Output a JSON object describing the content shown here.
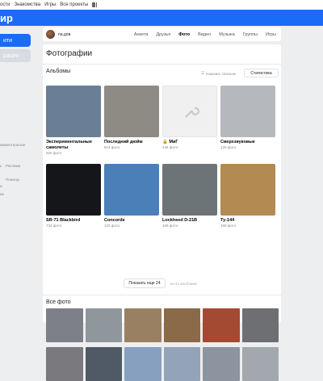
{
  "topnav": {
    "items": [
      "ости",
      "Знакомства",
      "Игры",
      "Все проекты"
    ]
  },
  "header": {
    "title": "ир"
  },
  "sidebar": {
    "active_label": "ити",
    "second_label": "рация",
    "texts": [
      "имментальные",
      "ь",
      "Реклама",
      "Помощь",
      "ы",
      "ие"
    ]
  },
  "profile": {
    "name": "па.дов",
    "tabs": [
      "Анкета",
      "Друзья",
      "Фото",
      "Видео",
      "Музыка",
      "Группы",
      "Игры"
    ],
    "active_tab": "Фото"
  },
  "page": {
    "title": "Фотографии",
    "albums_heading": "Альбомы",
    "show_list": "показать списком",
    "stats_button": "Статистика",
    "more_button": "Показать еще 24",
    "more_sub": "из 44 альбомов",
    "all_photos_heading": "Все фото"
  },
  "albums": [
    {
      "name": "Экспериментальные самолеты",
      "count": "920 фото",
      "color": "#6a7e96"
    },
    {
      "name": "Последний дюйм",
      "count": "814 фото",
      "color": "#8e8a84"
    },
    {
      "name": "🔒 МиГ",
      "count": "446 фото",
      "color": "#f0f0f0"
    },
    {
      "name": "Сверхзвуковые",
      "count": "129 фото",
      "color": "#b5b8bd"
    },
    {
      "name": "SR-71 Blackbird",
      "count": "734 фото",
      "color": "#15161a"
    },
    {
      "name": "Concorde",
      "count": "120 фото",
      "color": "#4a7fb8"
    },
    {
      "name": "Lockheed D-21B",
      "count": "108 фото",
      "color": "#6d7478"
    },
    {
      "name": "Ту-144",
      "count": "169 фото",
      "color": "#b38a52"
    }
  ],
  "all_photos": [
    {
      "color": "#7d8088"
    },
    {
      "color": "#8f969c"
    },
    {
      "color": "#9a8062"
    },
    {
      "color": "#8b6a48"
    },
    {
      "color": "#a54a32"
    },
    {
      "color": "#6e6f72"
    },
    {
      "color": "#7a7a7e"
    },
    {
      "color": "#4f5a66"
    },
    {
      "color": "#88a0bf"
    },
    {
      "color": "#93a3b8"
    },
    {
      "color": "#8c94a0"
    },
    {
      "color": "#a3a8ae"
    }
  ]
}
